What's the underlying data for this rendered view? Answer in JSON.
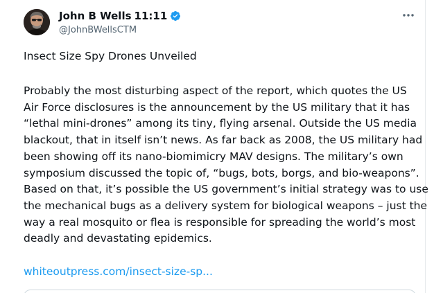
{
  "tweet": {
    "author_name": "John B Wells",
    "time": "11:11",
    "handle": "@JohnBWellsCTM",
    "title": "Insect Size Spy Drones Unveiled",
    "body_lines": [
      "Probably the most disturbing aspect of the report, which quotes the US",
      "Air Force disclosures is the announcement by the US military that it has",
      "“lethal mini-drones” among its tiny, flying arsenal. Outside the US media",
      "blackout, that in itself isn’t news. As far back as 2008, the US military had",
      "been showing off its nano-biomimicry MAV designs. The military’s own",
      "symposium discussed the topic of, “bugs, bots, borgs, and bio-weapons”.",
      "Based on that, it’s possible the US government’s initial strategy was to use",
      "the mechanical bugs as a delivery system for biological weapons – just the",
      "way a real mosquito or flea is responsible for spreading the world’s most",
      "deadly and devastating epidemics."
    ],
    "link_text": "whiteoutpress.com/insect-size-sp...",
    "verified_color": "#1d9bf0",
    "link_color": "#1d9bf0"
  },
  "icons": {
    "verified": "verified-badge-icon",
    "more": "more-options-icon"
  }
}
